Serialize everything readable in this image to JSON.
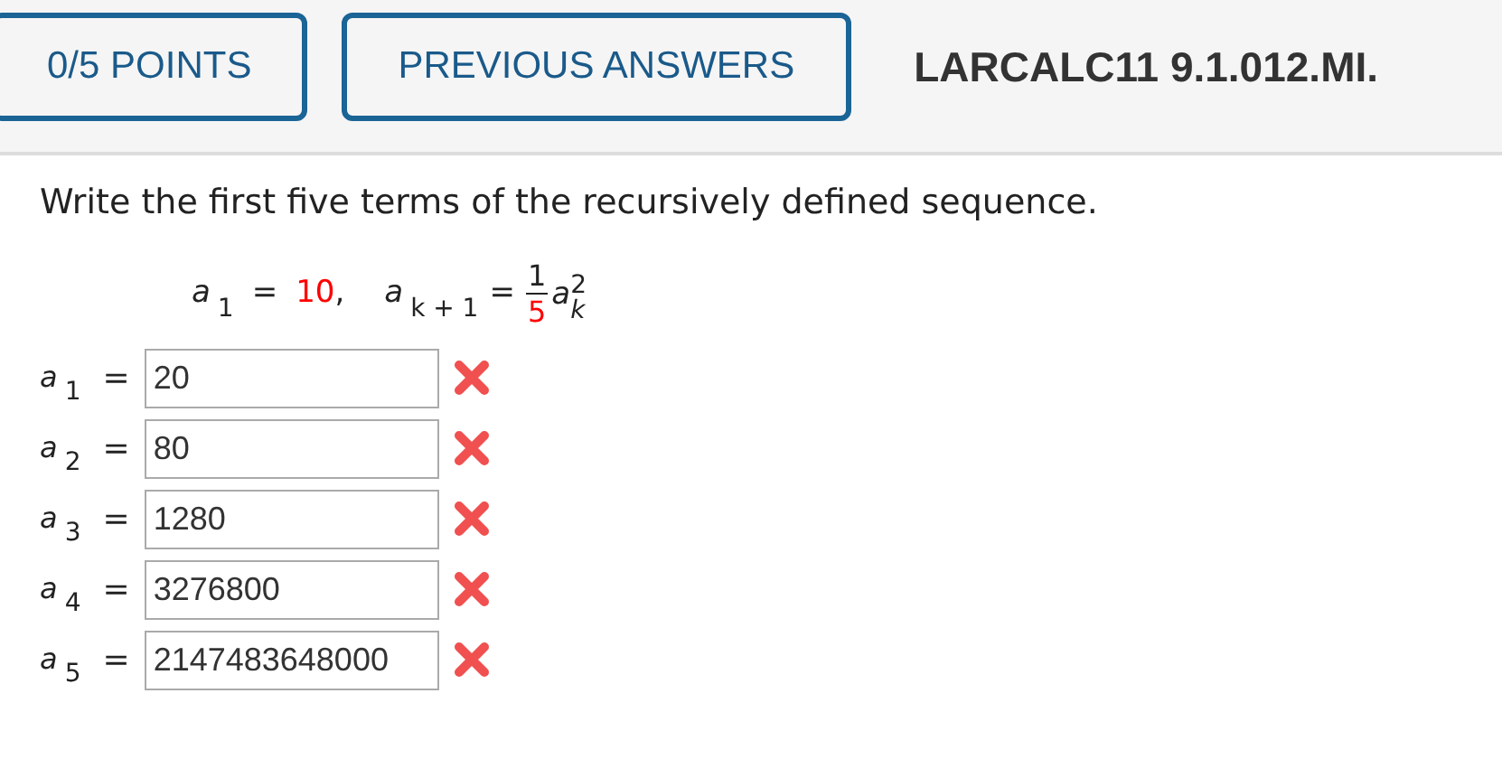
{
  "header": {
    "buttons": [
      {
        "label": "0/5 POINTS"
      },
      {
        "label": "PREVIOUS ANSWERS"
      }
    ],
    "title": "LARCALC11 9.1.012.MI."
  },
  "question": {
    "prompt": "Write the first five terms of the recursively defined sequence.",
    "recurrence": {
      "initial": {
        "symbol": "a",
        "subscript": "1",
        "equals": "=",
        "value": "10",
        "separator": ","
      },
      "rule": {
        "symbol": "a",
        "subscript": "k + 1",
        "equals": "=",
        "numerator": "1",
        "denominator": "5",
        "term_symbol": "a",
        "term_subscript": "k",
        "exponent": "2"
      }
    },
    "answers": [
      {
        "symbol": "a",
        "subscript": "1",
        "equals": "=",
        "value": "20",
        "correct": false
      },
      {
        "symbol": "a",
        "subscript": "2",
        "equals": "=",
        "value": "80",
        "correct": false
      },
      {
        "symbol": "a",
        "subscript": "3",
        "equals": "=",
        "value": "1280",
        "correct": false
      },
      {
        "symbol": "a",
        "subscript": "4",
        "equals": "=",
        "value": "3276800",
        "correct": false
      },
      {
        "symbol": "a",
        "subscript": "5",
        "equals": "=",
        "value": "2147483648000",
        "correct": false
      }
    ]
  }
}
